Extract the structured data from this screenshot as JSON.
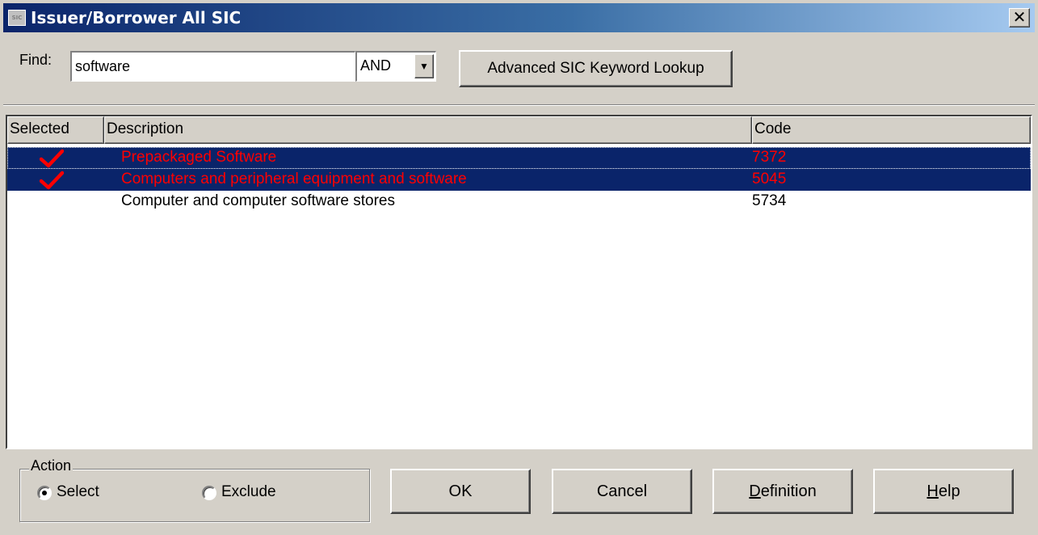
{
  "window": {
    "icon_text": "SIC",
    "title": "Issuer/Borrower All SIC",
    "close_glyph": "✕"
  },
  "search": {
    "label": "Find:",
    "value": "software",
    "operator": "AND",
    "dropdown_glyph": "▼",
    "advanced_button": "Advanced SIC Keyword Lookup"
  },
  "list": {
    "columns": [
      "Selected",
      "Description",
      "Code"
    ],
    "rows": [
      {
        "selected": true,
        "description": "Prepackaged Software",
        "code": "7372"
      },
      {
        "selected": true,
        "description": "Computers and peripheral equipment and software",
        "code": "5045"
      },
      {
        "selected": false,
        "description": "Computer and computer software stores",
        "code": "5734"
      }
    ],
    "check_color": "#ff0000",
    "selected_row_color": "#0a246a"
  },
  "action": {
    "legend": "Action",
    "options": [
      {
        "label": "Select",
        "checked": true
      },
      {
        "label": "Exclude",
        "checked": false
      }
    ]
  },
  "buttons": {
    "ok": "OK",
    "cancel": "Cancel",
    "definition_first": "D",
    "definition_rest": "efinition",
    "help_first": "H",
    "help_rest": "elp"
  }
}
